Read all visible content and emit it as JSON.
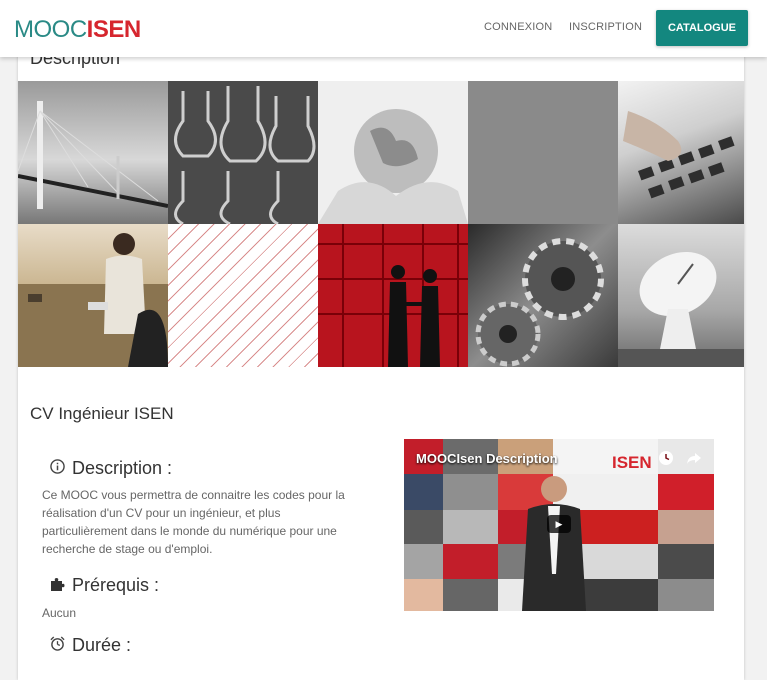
{
  "navbar": {
    "logo_part1": "MOOC",
    "logo_part2": "ISEN",
    "links": [
      "CONNEXION",
      "INSCRIPTION"
    ],
    "catalogue_button": "CATALOGUE"
  },
  "colors": {
    "brand_teal": "#2a8a86",
    "brand_red": "#d6262e",
    "button_bg": "#13877f"
  },
  "page": {
    "cut_heading": "Description",
    "course_title": "CV Ingénieur ISEN"
  },
  "description": {
    "heading": "Description :",
    "icon": "info-circle-icon",
    "text": "Ce MOOC vous permettra de connaitre les codes pour la réalisation d'un CV pour un ingénieur, et plus particulièrement dans le monde du numérique pour une recherche de stage ou d'emploi."
  },
  "prerequis": {
    "heading": "Prérequis :",
    "icon": "puzzle-icon",
    "text": "Aucun"
  },
  "duree": {
    "heading": "Durée :",
    "icon": "alarm-clock-icon"
  },
  "video": {
    "title": "MOOCIsen Description",
    "brand": "ISEN"
  }
}
